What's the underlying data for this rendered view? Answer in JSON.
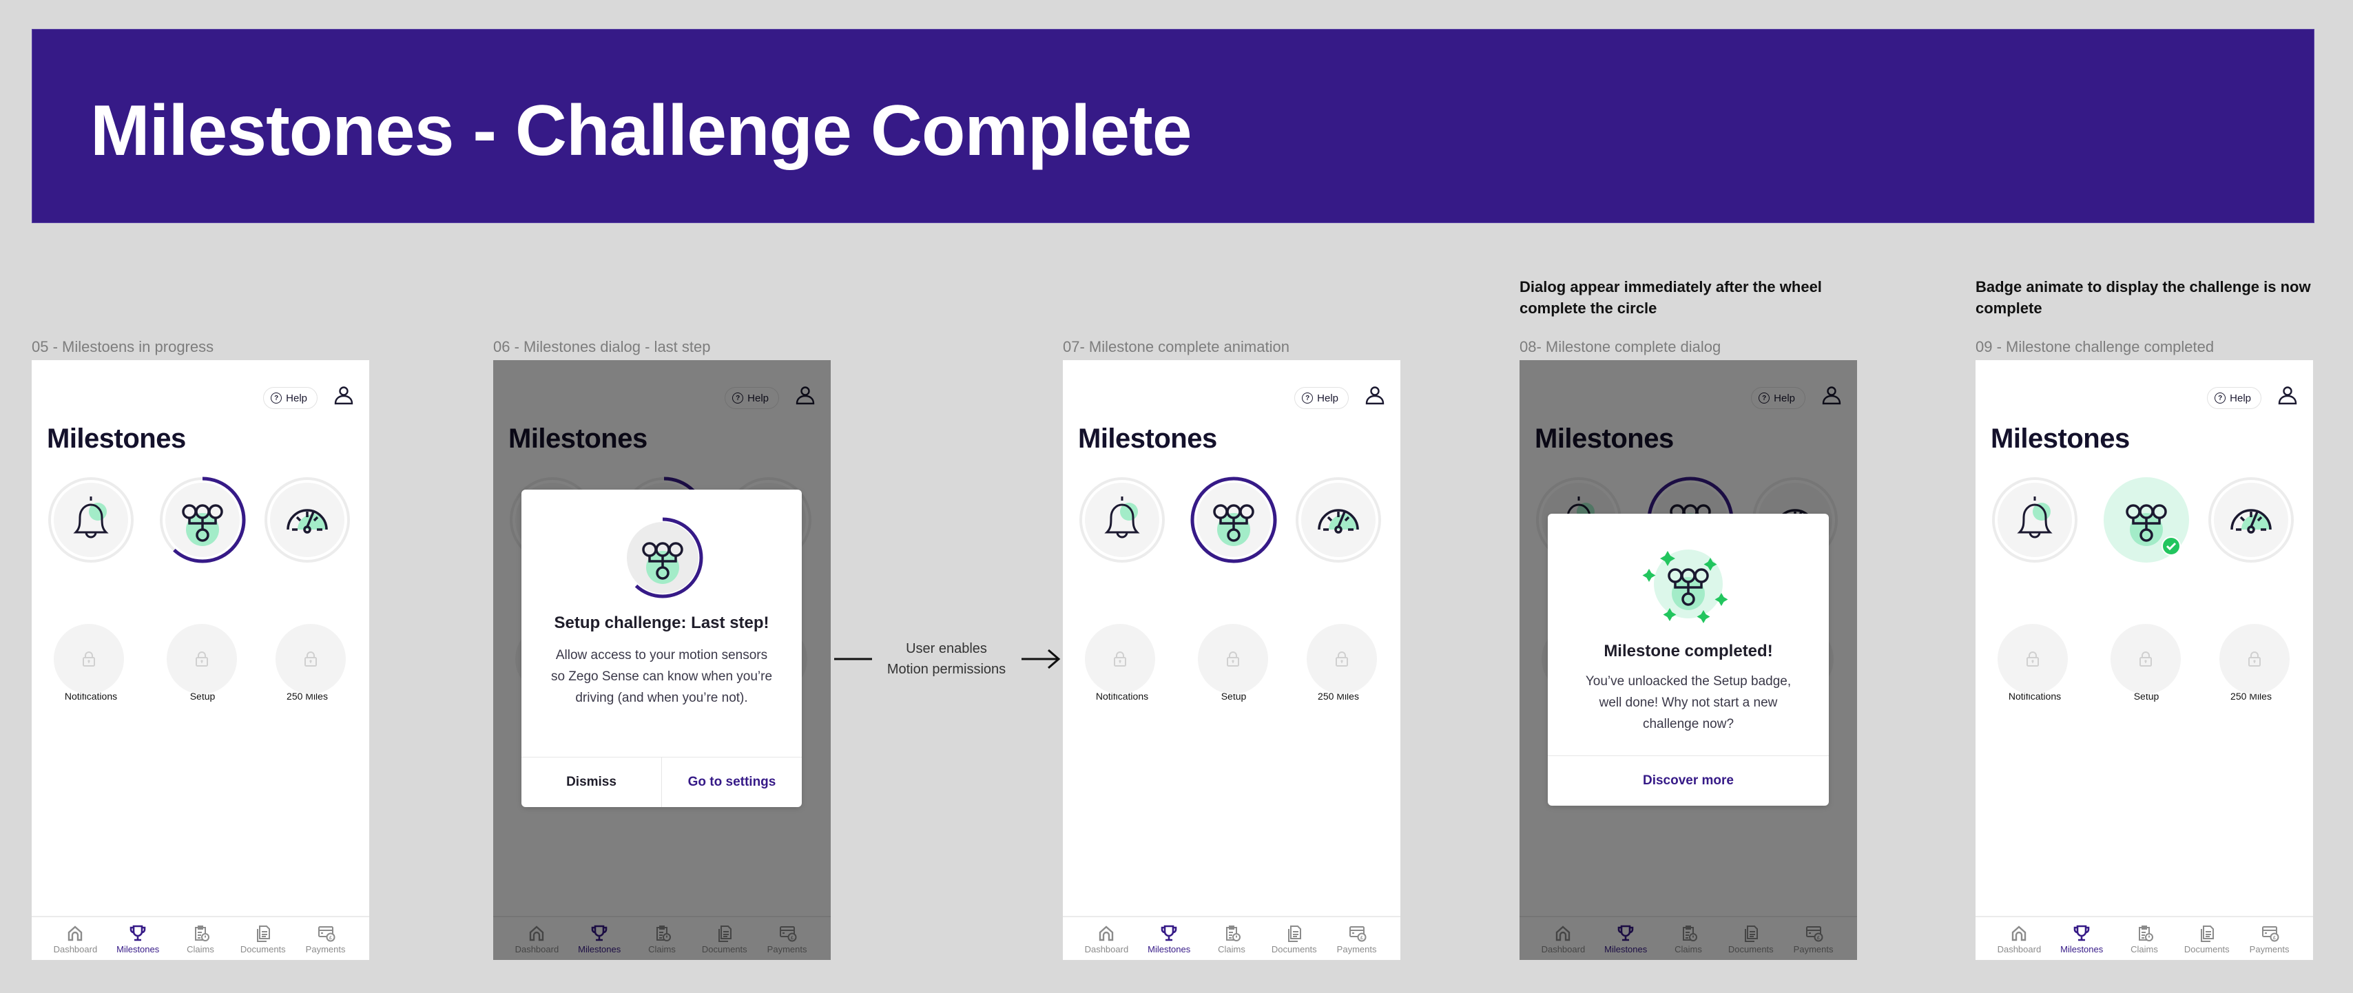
{
  "banner": {
    "title": "Milestones - Challenge Complete"
  },
  "colors": {
    "brand": "#361a87",
    "accent_green": "#a3ecc8",
    "success_green": "#22c55e",
    "background": "#d9d9d9",
    "frame_label": "#7d7d7d"
  },
  "annotations": {
    "flow_arrow": {
      "line1": "User enables",
      "line2": "Motion permissions"
    },
    "note_dialog": "Dialog appear immediately after the wheel complete the circle",
    "note_badge": "Badge animate to display the challenge is now complete"
  },
  "common": {
    "help_label": "Help",
    "help_icon": "question-circle-icon",
    "profile_icon": "user-icon",
    "page_title": "Milestones",
    "badges": [
      {
        "label": "Notifications",
        "icon": "bell-icon"
      },
      {
        "label": "Setup",
        "icon": "setup-tree-icon"
      },
      {
        "label": "250 Miles",
        "icon": "speedometer-icon"
      }
    ],
    "locked_icon": "lock-icon",
    "locked_count": 3,
    "nav": [
      {
        "label": "Dashboard",
        "icon": "home-icon",
        "active": false
      },
      {
        "label": "Milestones",
        "icon": "trophy-icon",
        "active": true
      },
      {
        "label": "Claims",
        "icon": "claims-icon",
        "active": false
      },
      {
        "label": "Documents",
        "icon": "documents-icon",
        "active": false
      },
      {
        "label": "Payments",
        "icon": "payments-icon",
        "active": false
      }
    ]
  },
  "frames": [
    {
      "label": "05 - Milestoens in progress",
      "setup_progress": 0.62,
      "dimmed": false
    },
    {
      "label": "06 - Milestones dialog - last step",
      "setup_progress": 0.62,
      "dimmed": true
    },
    {
      "label": "07- Milestone complete animation",
      "setup_progress": 1.0,
      "dimmed": false
    },
    {
      "label": "08- Milestone complete dialog",
      "setup_progress": 1.0,
      "dimmed": true
    },
    {
      "label": "09 - Milestone challenge completed",
      "setup_progress": 1.0,
      "dimmed": false,
      "setup_completed": true
    }
  ],
  "dialog_last_step": {
    "title": "Setup challenge: Last step!",
    "body": "Allow access to your motion sensors so Zego Sense can know when you’re driving (and when you’re not).",
    "dismiss_label": "Dismiss",
    "settings_label": "Go to settings",
    "progress": 0.62
  },
  "dialog_completed": {
    "title": "Milestone completed!",
    "body": "You’ve unloacked the Setup badge, well done! Why not start a new challenge now?",
    "action_label": "Discover more"
  }
}
